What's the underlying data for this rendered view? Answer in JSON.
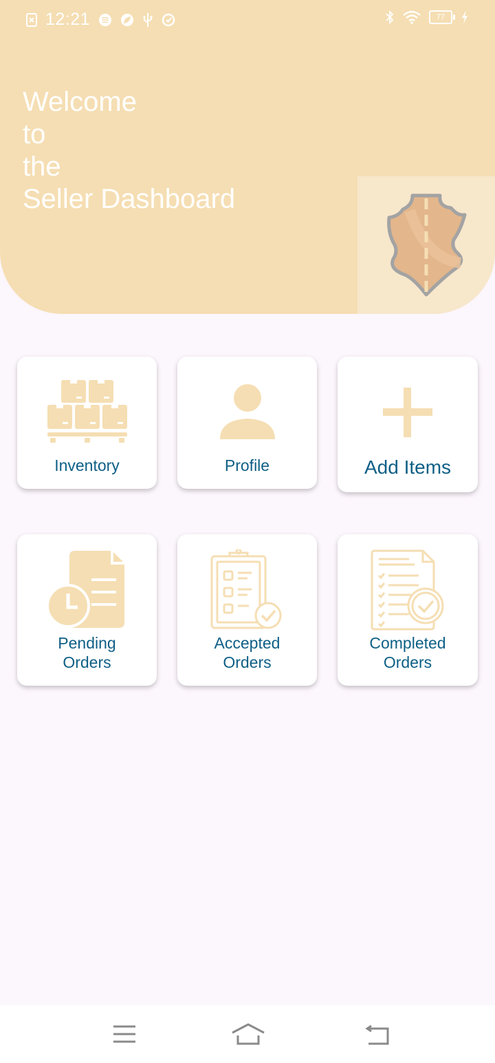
{
  "status_bar": {
    "time": "12:21",
    "battery": "77",
    "icons_left": [
      "screenshot-icon",
      "spotify-icon",
      "leaf-icon",
      "usb-icon",
      "sync-icon"
    ],
    "icons_right": [
      "bluetooth-icon",
      "wifi-icon",
      "battery-icon",
      "charging-icon"
    ]
  },
  "header": {
    "welcome_lines": [
      "Welcome",
      "to",
      "the",
      "Seller Dashboard"
    ],
    "logo": "leather-hide-logo"
  },
  "tiles": [
    {
      "label": "Inventory",
      "icon": "inventory-boxes-icon"
    },
    {
      "label": "Profile",
      "icon": "person-icon"
    },
    {
      "label": "Add Items",
      "icon": "plus-icon"
    },
    {
      "label_line1": "Pending",
      "label_line2": "Orders",
      "icon": "pending-document-clock-icon"
    },
    {
      "label_line1": "Accepted",
      "label_line2": "Orders",
      "icon": "clipboard-check-icon"
    },
    {
      "label_line1": "Completed",
      "label_line2": "Orders",
      "icon": "checklist-check-icon"
    }
  ],
  "nav": {
    "items": [
      "menu-icon",
      "home-icon",
      "back-icon"
    ]
  },
  "colors": {
    "header": "#f5deb3",
    "icon": "#f5deb3",
    "label": "#0e5f86",
    "background": "#fcf6fd"
  }
}
